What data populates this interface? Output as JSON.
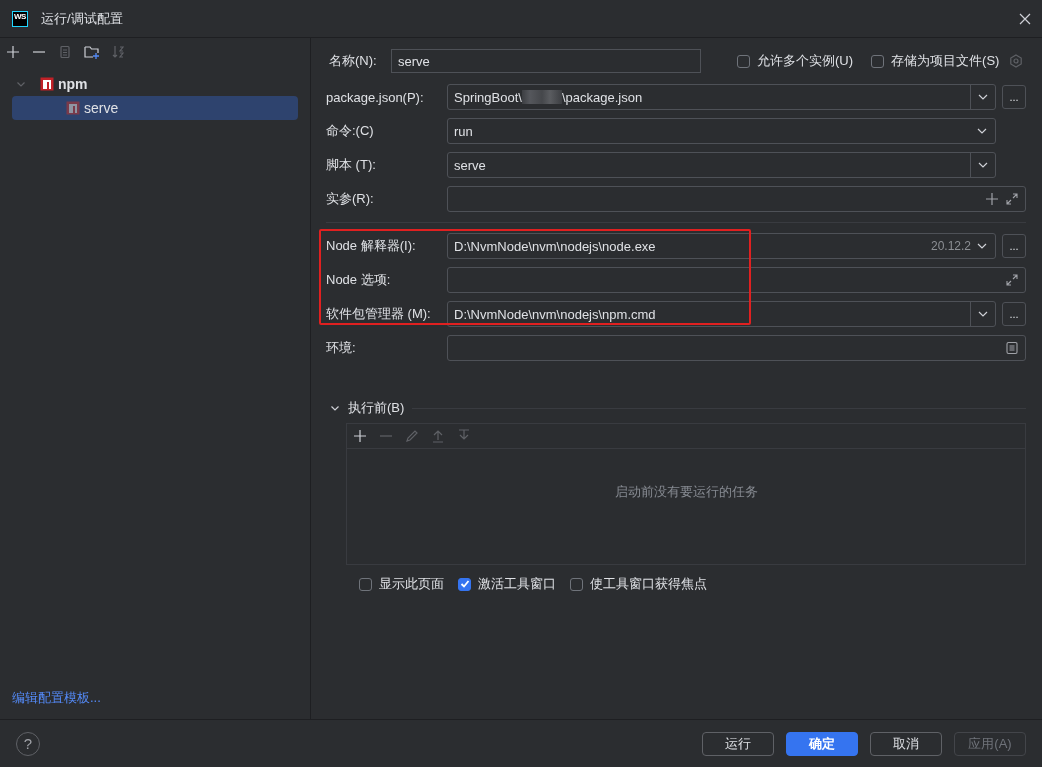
{
  "window": {
    "logo_text": "WS",
    "title": "运行/调试配置"
  },
  "sidebar": {
    "tree": [
      {
        "label": "npm",
        "expanded": true,
        "selected": false,
        "children": [
          {
            "label": "serve",
            "selected": true
          }
        ]
      }
    ],
    "footer_link": "编辑配置模板..."
  },
  "form": {
    "name": {
      "label": "名称(N):",
      "value": "serve"
    },
    "options": [
      {
        "label": "允许多个实例(U)",
        "checked": false
      },
      {
        "label": "存储为项目文件(S)",
        "checked": false
      }
    ],
    "sections": [
      {
        "highlighted": false,
        "fields": [
          {
            "kind": "combo",
            "label": "package.json(P):",
            "value": "SpringBoot\\",
            "value_end": "\\package.json",
            "redacted": true,
            "browse": "..."
          },
          {
            "kind": "select",
            "label": "命令:(C)",
            "value": "run"
          },
          {
            "kind": "combo",
            "label": "脚本 (T):",
            "value": "serve"
          },
          {
            "kind": "args",
            "label": "实参(R):"
          }
        ]
      },
      {
        "highlighted": true,
        "fields": [
          {
            "kind": "select",
            "label": "Node 解释器(I):",
            "value": "D:\\NvmNode\\nvm\\nodejs\\node.exe",
            "version": "20.12.2",
            "browse": "..."
          },
          {
            "kind": "expand",
            "label": "Node 选项:"
          },
          {
            "kind": "combo",
            "label": "软件包管理器 (M):",
            "value": "D:\\NvmNode\\nvm\\nodejs\\npm.cmd",
            "browse": "..."
          }
        ]
      },
      {
        "highlighted": false,
        "fields": [
          {
            "kind": "env",
            "label": "环境:"
          }
        ]
      }
    ],
    "before_launch": {
      "label": "执行前(B)",
      "expanded": true,
      "empty_text": "启动前没有要运行的任务"
    },
    "checkboxes": [
      {
        "label": "显示此页面",
        "checked": false
      },
      {
        "label": "激活工具窗口",
        "checked": true
      },
      {
        "label": "使工具窗口获得焦点",
        "checked": false
      }
    ]
  },
  "footer": {
    "help": "?",
    "buttons": [
      {
        "label": "运行",
        "kind": "normal"
      },
      {
        "label": "确定",
        "kind": "primary"
      },
      {
        "label": "取消",
        "kind": "normal"
      },
      {
        "label": "应用(A)",
        "kind": "disabled"
      }
    ]
  }
}
